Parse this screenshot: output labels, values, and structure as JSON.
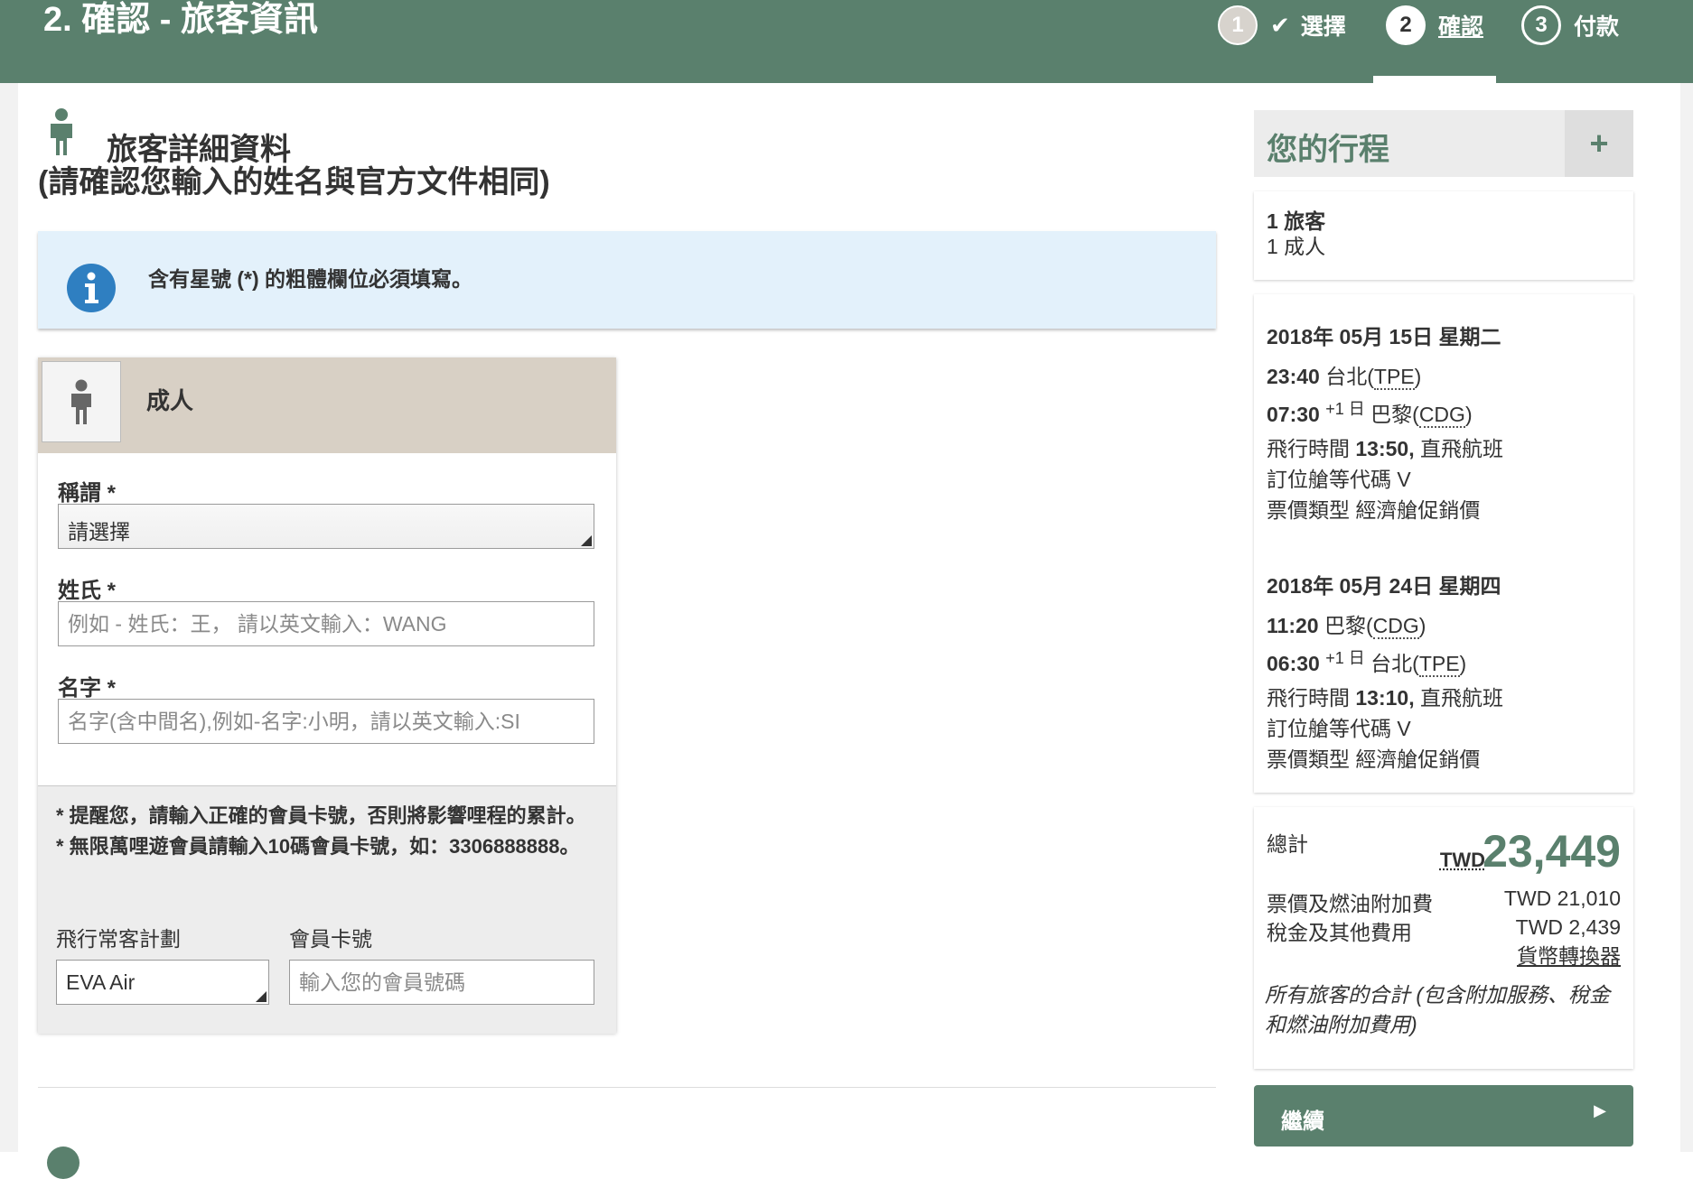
{
  "header": {
    "title": "2. 確認 - 旅客資訊",
    "steps": [
      {
        "number": "1",
        "label": "選擇",
        "check": "✔"
      },
      {
        "number": "2",
        "label": "確認"
      },
      {
        "number": "3",
        "label": "付款"
      }
    ]
  },
  "section": {
    "title": "旅客詳細資料",
    "subtitle": "(請確認您輸入的姓名與官方文件相同)"
  },
  "info": {
    "text": "含有星號 (*) 的粗體欄位必須填寫。"
  },
  "passenger": {
    "type": "成人",
    "title_label": "稱謂 *",
    "title_value": "請選擇",
    "lastname_label": "姓氏 *",
    "lastname_placeholder": "例如 - 姓氏：王， 請以英文輸入：WANG",
    "firstname_label": "名字 *",
    "firstname_placeholder": "名字(含中間名),例如-名字:小明，請以英文輸入:SI",
    "ffp": {
      "note": "* 提醒您，請輸入正確的會員卡號，否則將影響哩程的累計。\n* 無限萬哩遊會員請輸入10碼會員卡號，如：3306888888。",
      "program_label": "飛行常客計劃",
      "program_value": "EVA Air",
      "number_label": "會員卡號",
      "number_placeholder": "輸入您的會員號碼"
    }
  },
  "itinerary": {
    "title": "您的行程",
    "pax_count": "1 旅客",
    "pax_detail": "1 成人",
    "outbound": {
      "date": "2018年 05月 15日 星期二",
      "dep_time": "23:40",
      "dep_city": "台北(",
      "dep_code": "TPE",
      "arr_time": "07:30",
      "arr_offset": "+1 日",
      "arr_city": "巴黎(",
      "arr_code": "CDG",
      "duration_label": "飛行時間 ",
      "duration": "13:50,",
      "flight_type": " 直飛航班",
      "booking_class": "訂位艙等代碼 V",
      "fare_type": "票價類型 經濟艙促銷價"
    },
    "inbound": {
      "date": "2018年 05月 24日 星期四",
      "dep_time": "11:20",
      "dep_city": "巴黎(",
      "dep_code": "CDG",
      "arr_time": "06:30",
      "arr_offset": "+1 日",
      "arr_city": "台北(",
      "arr_code": "TPE",
      "duration_label": "飛行時間 ",
      "duration": "13:10,",
      "flight_type": " 直飛航班",
      "booking_class": "訂位艙等代碼 V",
      "fare_type": "票價類型 經濟艙促銷價"
    },
    "total": {
      "label": "總計",
      "currency": "TWD",
      "amount": "23,449",
      "fare_label": "票價及燃油附加費",
      "fare_value": "TWD 21,010",
      "tax_label": "稅金及其他費用",
      "tax_value": "TWD 2,439",
      "converter": "貨幣轉換器",
      "note": "所有旅客的合計 (包含附加服務、稅金和燃油附加費用)"
    },
    "continue_label": "繼續"
  },
  "colors": {
    "brand": "#5a806d",
    "info_bg": "#e3f1fb",
    "pax_head": "#d8d0c5",
    "info_icon": "#2f7fc1"
  }
}
